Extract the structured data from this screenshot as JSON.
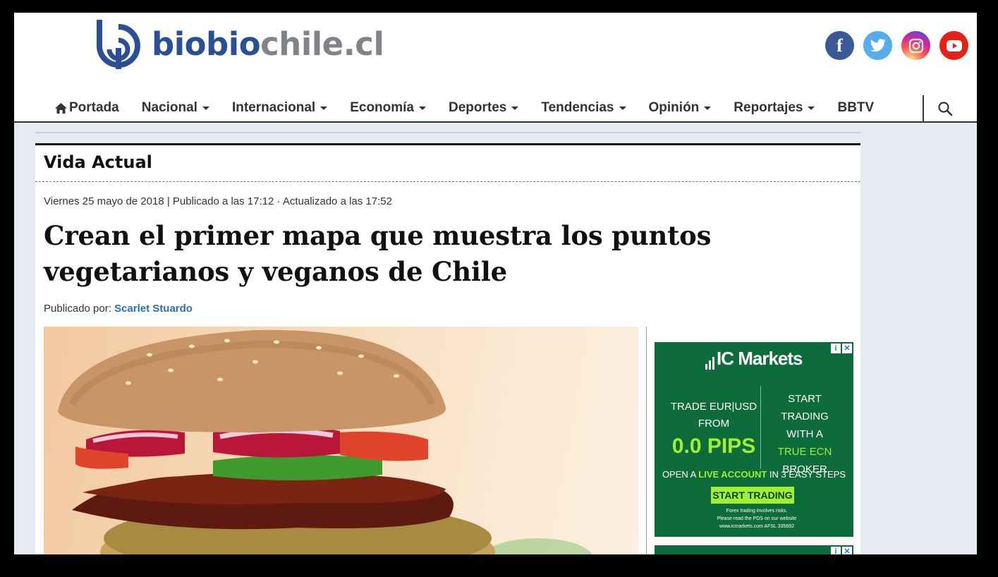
{
  "site": {
    "logo_part1": "biobio",
    "logo_part2": "chile.cl"
  },
  "social": [
    {
      "name": "facebook",
      "icon": "facebook-icon",
      "color": "#3b5998"
    },
    {
      "name": "twitter",
      "icon": "twitter-icon",
      "color": "#55acee"
    },
    {
      "name": "instagram",
      "icon": "instagram-icon",
      "color": "#d6249f"
    },
    {
      "name": "youtube",
      "icon": "youtube-icon",
      "color": "#e62117"
    }
  ],
  "nav": {
    "items": [
      {
        "label": "Portada",
        "dropdown": false,
        "icon": "home-icon"
      },
      {
        "label": "Nacional",
        "dropdown": true
      },
      {
        "label": "Internacional",
        "dropdown": true
      },
      {
        "label": "Economía",
        "dropdown": true
      },
      {
        "label": "Deportes",
        "dropdown": true
      },
      {
        "label": "Tendencias",
        "dropdown": true
      },
      {
        "label": "Opinión",
        "dropdown": true
      },
      {
        "label": "Reportajes",
        "dropdown": true
      },
      {
        "label": "BBTV",
        "dropdown": false
      }
    ],
    "search_icon": "search-icon"
  },
  "article": {
    "section": "Vida Actual",
    "meta": "Viernes 25 mayo de 2018 | Publicado a las 17:12 · Actualizado a las 17:52",
    "headline": "Crean el primer mapa que muestra los puntos vegetarianos y veganos de Chile",
    "byline_prefix": "Publicado por:",
    "author": "Scarlet Stuardo"
  },
  "ad": {
    "brand": "IC Markets",
    "left_line1": "TRADE EUR|USD",
    "left_line2": "FROM",
    "pips": "0.0 PIPS",
    "right_line1": "START TRADING",
    "right_line2": "WITH A",
    "right_line3": "TRUE ECN",
    "right_line4": "BROKER",
    "steps_prefix": "OPEN A",
    "steps_highlight": "LIVE ACCOUNT",
    "steps_suffix": "IN 3 EASY STEPS",
    "cta": "START TRADING",
    "fine1": "Forex trading involves risks.",
    "fine2": "Please read the PDS on our website",
    "fine3": "www.icmarkets.com AFSL 335692",
    "adchoices": "i",
    "close": "✕"
  },
  "colors": {
    "brand_blue": "#2a4f94",
    "brand_gray": "#808489",
    "link": "#2a6eb5",
    "ad_green": "#0e6b3a",
    "ad_accent": "#9ff032"
  }
}
